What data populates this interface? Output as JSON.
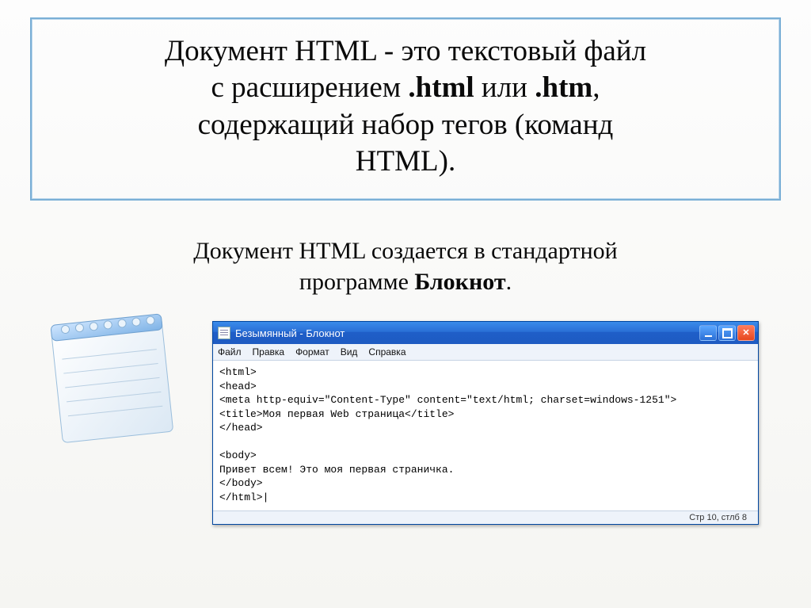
{
  "title_box": {
    "line1": "Документ HTML - это текстовый файл",
    "line2_a": "с расширением ",
    "line2_b1": ".html",
    "line2_c": " или ",
    "line2_b2": ".htm",
    "line2_d": ",",
    "line3": "содержащий набор тегов (команд",
    "line4": "HTML)."
  },
  "subheading": {
    "a": "Документ HTML создается в стандартной",
    "b_pre": "программе ",
    "b_bold": "Блокнот",
    "b_post": "."
  },
  "xp": {
    "title": "Безымянный - Блокнот",
    "menu": [
      "Файл",
      "Правка",
      "Формат",
      "Вид",
      "Справка"
    ],
    "code": "<html>\n<head>\n<meta http-equiv=\"Content-Type\" content=\"text/html; charset=windows-1251\">\n<title>Моя первая Web страница</title>\n</head>\n\n<body>\nПривет всем! Это моя первая страничка.\n</body>\n</html>|",
    "status": "Стр 10, стлб 8"
  }
}
